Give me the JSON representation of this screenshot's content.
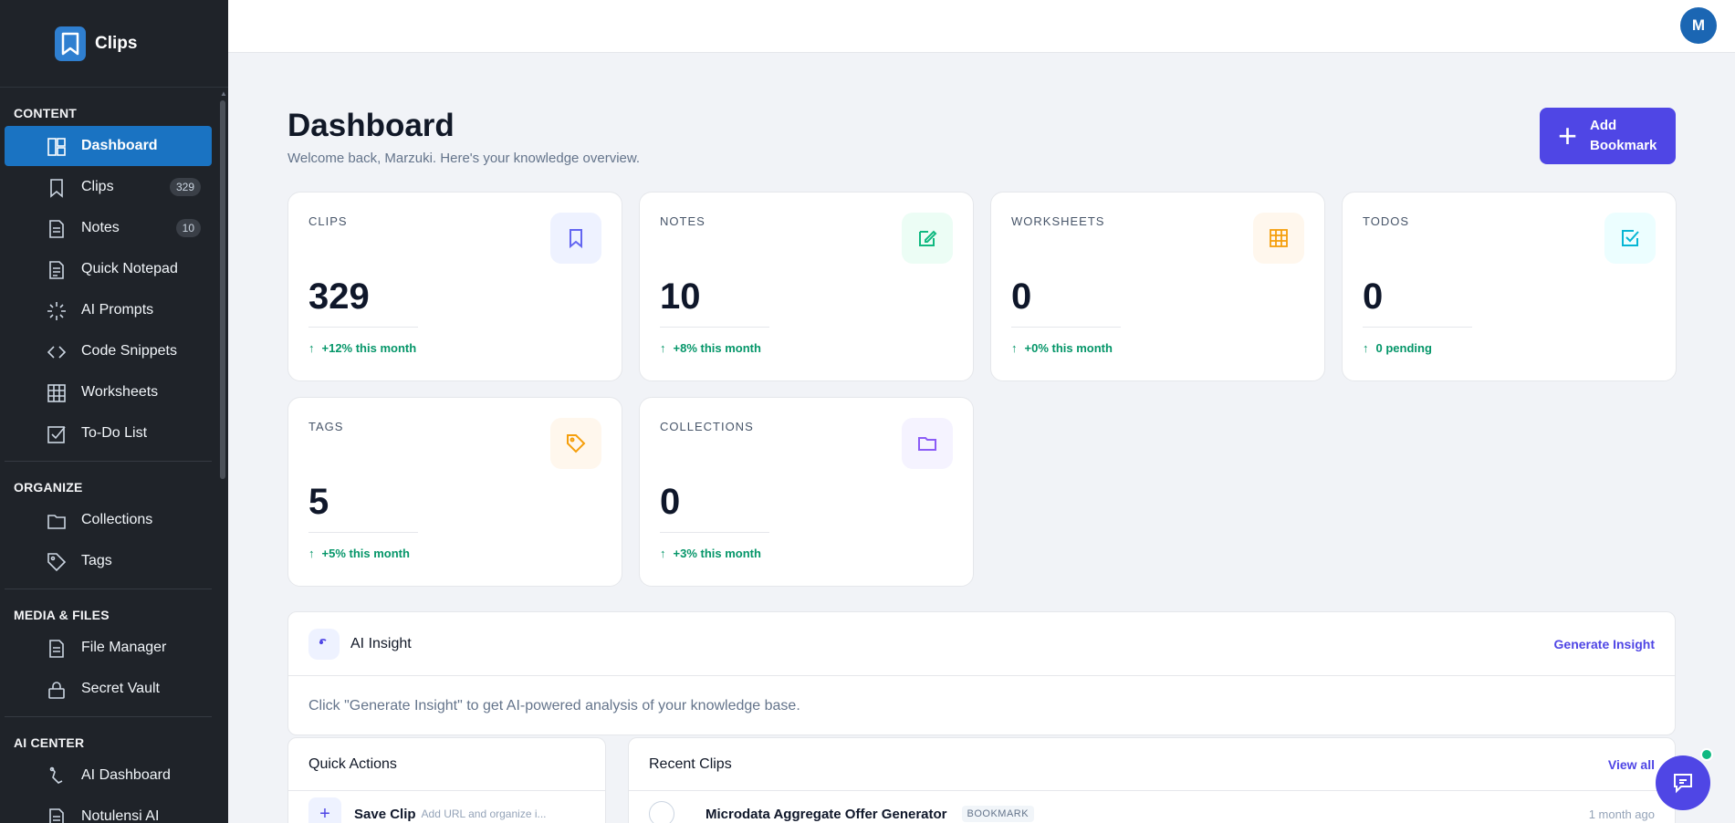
{
  "app": {
    "name": "Clips"
  },
  "user": {
    "initial": "M"
  },
  "sidebar": {
    "sections": [
      {
        "title": "CONTENT",
        "items": [
          {
            "label": "Dashboard",
            "icon": "dashboard-icon",
            "active": true
          },
          {
            "label": "Clips",
            "icon": "bookmark-icon",
            "count": "329"
          },
          {
            "label": "Notes",
            "icon": "note-icon",
            "count": "10"
          },
          {
            "label": "Quick Notepad",
            "icon": "notepad-icon"
          },
          {
            "label": "AI Prompts",
            "icon": "spark-icon"
          },
          {
            "label": "Code Snippets",
            "icon": "code-icon"
          },
          {
            "label": "Worksheets",
            "icon": "grid-icon"
          },
          {
            "label": "To-Do List",
            "icon": "checkbox-icon"
          }
        ]
      },
      {
        "title": "ORGANIZE",
        "items": [
          {
            "label": "Collections",
            "icon": "folder-icon"
          },
          {
            "label": "Tags",
            "icon": "tag-icon"
          }
        ]
      },
      {
        "title": "MEDIA & FILES",
        "items": [
          {
            "label": "File Manager",
            "icon": "file-icon"
          },
          {
            "label": "Secret Vault",
            "icon": "lock-icon"
          }
        ]
      },
      {
        "title": "AI CENTER",
        "items": [
          {
            "label": "AI Dashboard",
            "icon": "ai-icon"
          },
          {
            "label": "Notulensi AI",
            "icon": "file-icon"
          }
        ]
      }
    ]
  },
  "header": {
    "title": "Dashboard",
    "subtitle": "Welcome back, Marzuki. Here's your knowledge overview.",
    "add_button": "Add Bookmark"
  },
  "stats": [
    {
      "label": "CLIPS",
      "value": "329",
      "trend": "+12% this month",
      "icon": "bookmark-icon",
      "color": "#6366f1",
      "bg": "#eef2ff"
    },
    {
      "label": "NOTES",
      "value": "10",
      "trend": "+8% this month",
      "icon": "edit-icon",
      "color": "#10b981",
      "bg": "#ecfdf5"
    },
    {
      "label": "WORKSHEETS",
      "value": "0",
      "trend": "+0% this month",
      "icon": "grid-icon",
      "color": "#f59e0b",
      "bg": "#fff7ed"
    },
    {
      "label": "TODOS",
      "value": "0",
      "trend": "0 pending",
      "icon": "checkbox-icon",
      "color": "#06b6d4",
      "bg": "#ecfeff"
    },
    {
      "label": "TAGS",
      "value": "5",
      "trend": "+5% this month",
      "icon": "tag-icon",
      "color": "#f59e0b",
      "bg": "#fff7ed"
    },
    {
      "label": "COLLECTIONS",
      "value": "0",
      "trend": "+3% this month",
      "icon": "folder-icon",
      "color": "#8b5cf6",
      "bg": "#f5f3ff"
    }
  ],
  "insight": {
    "title": "AI Insight",
    "action": "Generate Insight",
    "body": "Click \"Generate Insight\" to get AI-powered analysis of your knowledge base."
  },
  "quick_actions": {
    "title": "Quick Actions",
    "first": {
      "label": "Save Clip",
      "desc": "Add URL and organize i..."
    }
  },
  "recent_clips": {
    "title": "Recent Clips",
    "view_all": "View all",
    "items": [
      {
        "title": "Microdata Aggregate Offer Generator",
        "type": "BOOKMARK",
        "time": "1 month ago"
      }
    ]
  }
}
